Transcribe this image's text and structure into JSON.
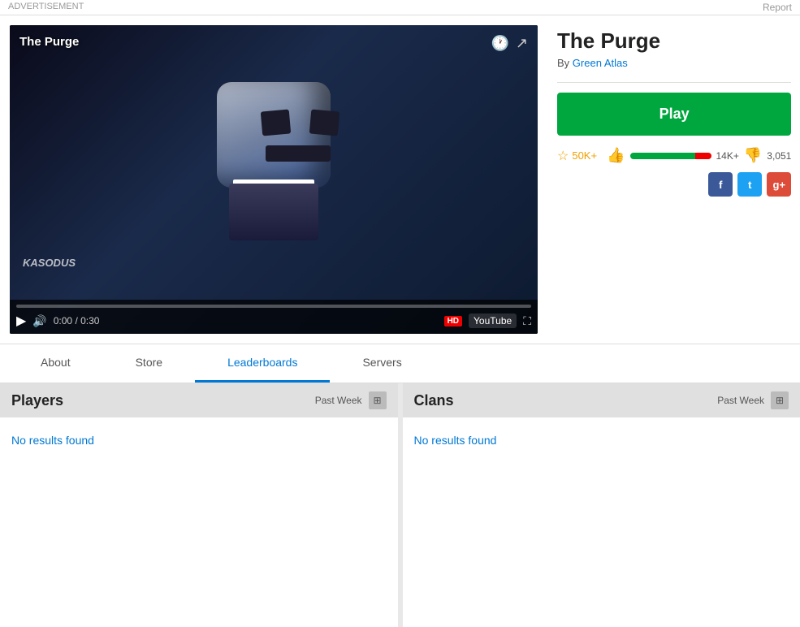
{
  "topbar": {
    "advertisement_label": "ADVERTISEMENT",
    "report_label": "Report"
  },
  "game": {
    "title": "The Purge",
    "author_label": "By",
    "author_name": "Green Atlas",
    "play_label": "Play",
    "star_count": "50K+",
    "like_count": "14K+",
    "dislike_count": "3,051",
    "like_percent": 80,
    "dislike_percent": 20,
    "video_title": "The Purge",
    "watermark": "KASODUS",
    "time_current": "0:00",
    "time_total": "0:30"
  },
  "tabs": [
    {
      "id": "about",
      "label": "About",
      "active": false
    },
    {
      "id": "store",
      "label": "Store",
      "active": false
    },
    {
      "id": "leaderboards",
      "label": "Leaderboards",
      "active": true
    },
    {
      "id": "servers",
      "label": "Servers",
      "active": false
    }
  ],
  "leaderboards": {
    "players": {
      "title": "Players",
      "time_filter": "Past Week",
      "no_results": "No results found"
    },
    "clans": {
      "title": "Clans",
      "time_filter": "Past Week",
      "no_results": "No results found"
    }
  },
  "social": {
    "facebook": "f",
    "twitter": "t",
    "googleplus": "g+"
  },
  "icons": {
    "clock": "🕐",
    "share": "↗",
    "play_triangle": "▶",
    "volume": "🔊",
    "hd": "HD",
    "youtube": "YouTube",
    "fullscreen": "⛶",
    "star": "☆",
    "thumbup": "👍",
    "thumbdown": "👎",
    "filter": "⊞"
  }
}
